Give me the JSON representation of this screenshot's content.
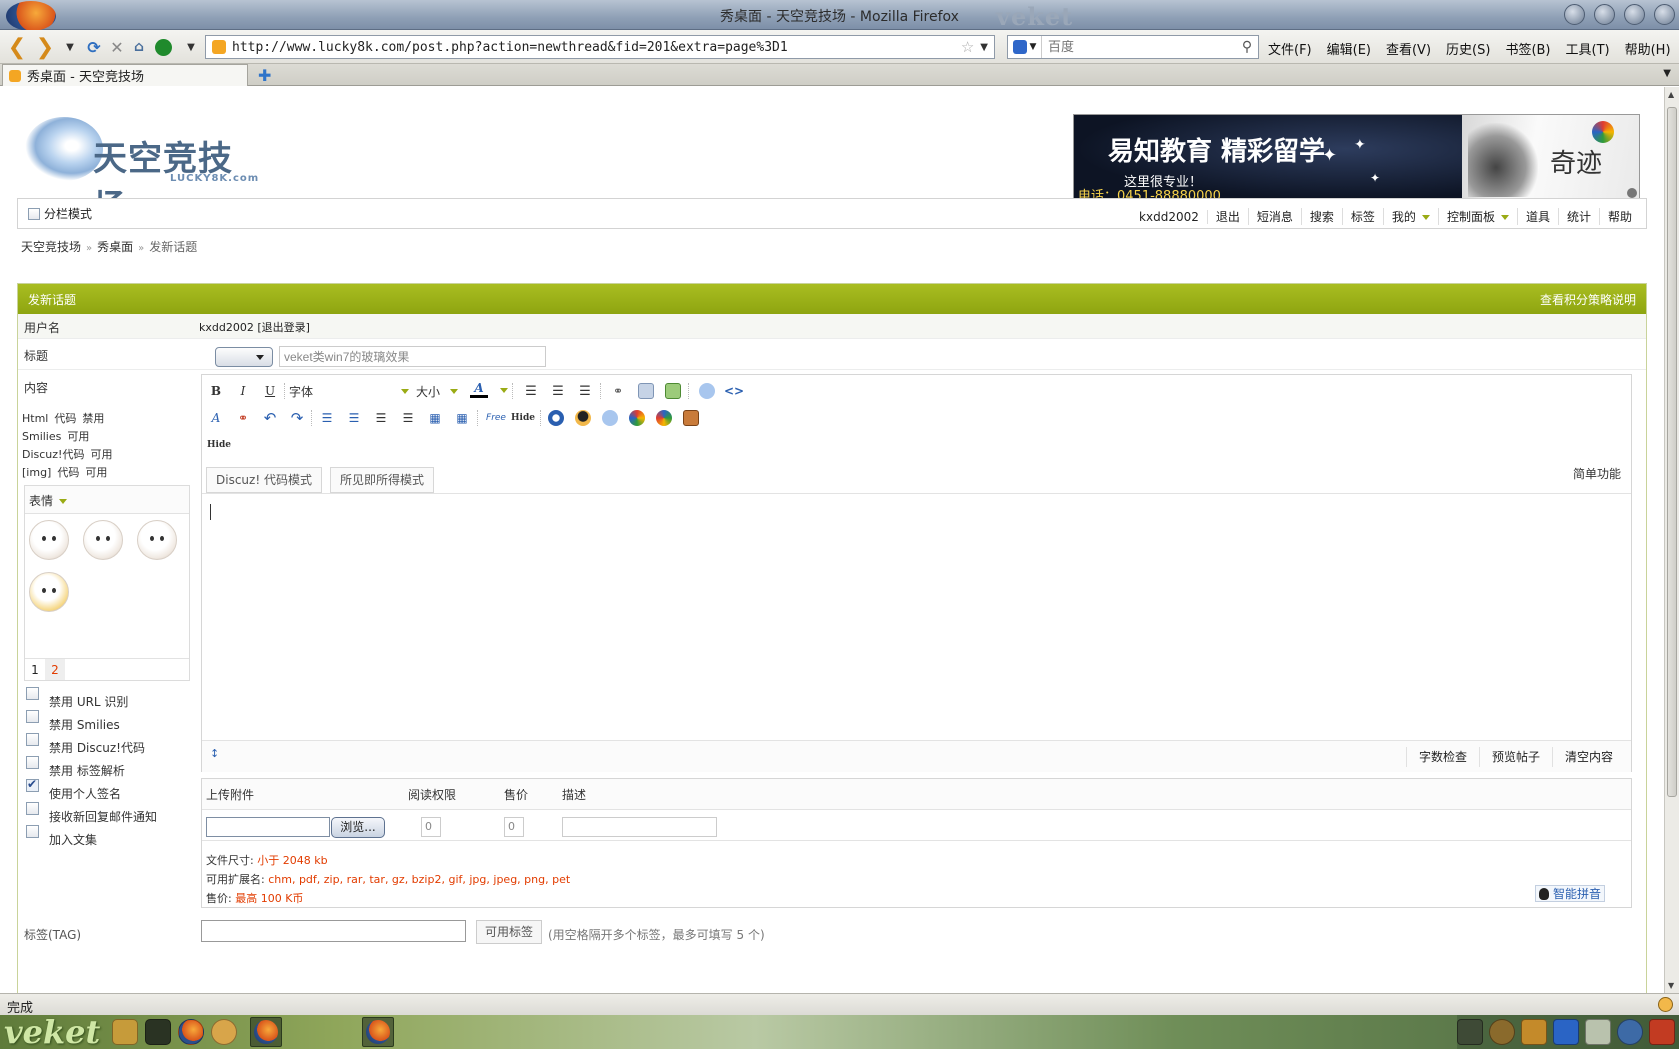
{
  "window": {
    "title": "秀桌面 - 天空竞技场 - Mozilla Firefox",
    "wm_brand": "veket"
  },
  "browser": {
    "url": "http://www.lucky8k.com/post.php?action=newthread&fid=201&extra=page%3D1",
    "search_placeholder": "百度",
    "menu": [
      "文件(F)",
      "编辑(E)",
      "查看(V)",
      "历史(S)",
      "书签(B)",
      "工具(T)",
      "帮助(H)"
    ],
    "tab_title": "秀桌面 - 天空竞技场",
    "status": "完成"
  },
  "site": {
    "logo_name": "天空竞技场",
    "logo_sub": "LUCKY8K.com",
    "banner": {
      "headline": "易知教育 精彩留学",
      "slogan": "这里很专业！",
      "phone": "电话：0451-88880000",
      "calligraphy": "奇迹"
    },
    "columns_mode": "分栏模式",
    "nav": {
      "username": "kxdd2002",
      "items": [
        "退出",
        "短消息",
        "搜索",
        "标签",
        "我的",
        "控制面板",
        "道具",
        "统计",
        "帮助"
      ]
    },
    "breadcrumb": [
      "天空竞技场",
      "秀桌面",
      "发新话题"
    ]
  },
  "form": {
    "title": "发新话题",
    "policy_link": "查看积分策略说明",
    "username_label": "用户名",
    "username_value": "kxdd2002 [退出登录]",
    "subject_label": "标题",
    "subject_value": "veket类win7的玻璃效果",
    "content_label": "内容",
    "status_list": [
      {
        "name": "Html",
        "items": [
          "代码",
          "禁用"
        ]
      },
      {
        "name": "Smilies",
        "items": [
          "可用"
        ]
      },
      {
        "name": "Discuz!代码",
        "items": [
          "可用"
        ]
      },
      {
        "name": "[img]",
        "items": [
          "代码",
          "可用"
        ]
      }
    ],
    "smilies_title": "表情",
    "smilies_pages": [
      "1",
      "2"
    ],
    "options": [
      {
        "label": "禁用 URL 识别",
        "checked": false
      },
      {
        "label": "禁用 Smilies",
        "checked": false
      },
      {
        "label": "禁用 Discuz!代码",
        "checked": false
      },
      {
        "label": "禁用 标签解析",
        "checked": false
      },
      {
        "label": "使用个人签名",
        "checked": true
      },
      {
        "label": "接收新回复邮件通知",
        "checked": false
      },
      {
        "label": "加入文集",
        "checked": false
      }
    ],
    "editor": {
      "bold": "B",
      "italic": "I",
      "underline": "U",
      "font_label": "字体",
      "size_label": "大小",
      "free_label": "Free",
      "hide_label": "Hide",
      "modes": [
        "Discuz! 代码模式",
        "所见即所得模式"
      ],
      "simple_mode": "简单功能",
      "footer_buttons": [
        "字数检查",
        "预览帖子",
        "清空内容"
      ]
    },
    "attach": {
      "headers": [
        "上传附件",
        "阅读权限",
        "售价",
        "描述"
      ],
      "browse": "浏览...",
      "read_perm": "0",
      "price": "0",
      "size_label": "文件尺寸:",
      "size_value": "小于 2048 kb",
      "ext_label": "可用扩展名:",
      "ext_value": "chm, pdf, zip, rar, tar, gz, bzip2, gif, jpg, jpeg, png, pet",
      "price_label": "售价:",
      "price_value": "最高 100 K币",
      "ime": "智能拼音"
    },
    "tag": {
      "label": "标签(TAG)",
      "button": "可用标签",
      "hint": "(用空格隔开多个标签，最多可填写 5 个)"
    }
  },
  "colors": {
    "accent": "#9aab15",
    "header_bg": "#a9bd21",
    "alert": "#e23c00",
    "link": "#2a5fb0"
  }
}
